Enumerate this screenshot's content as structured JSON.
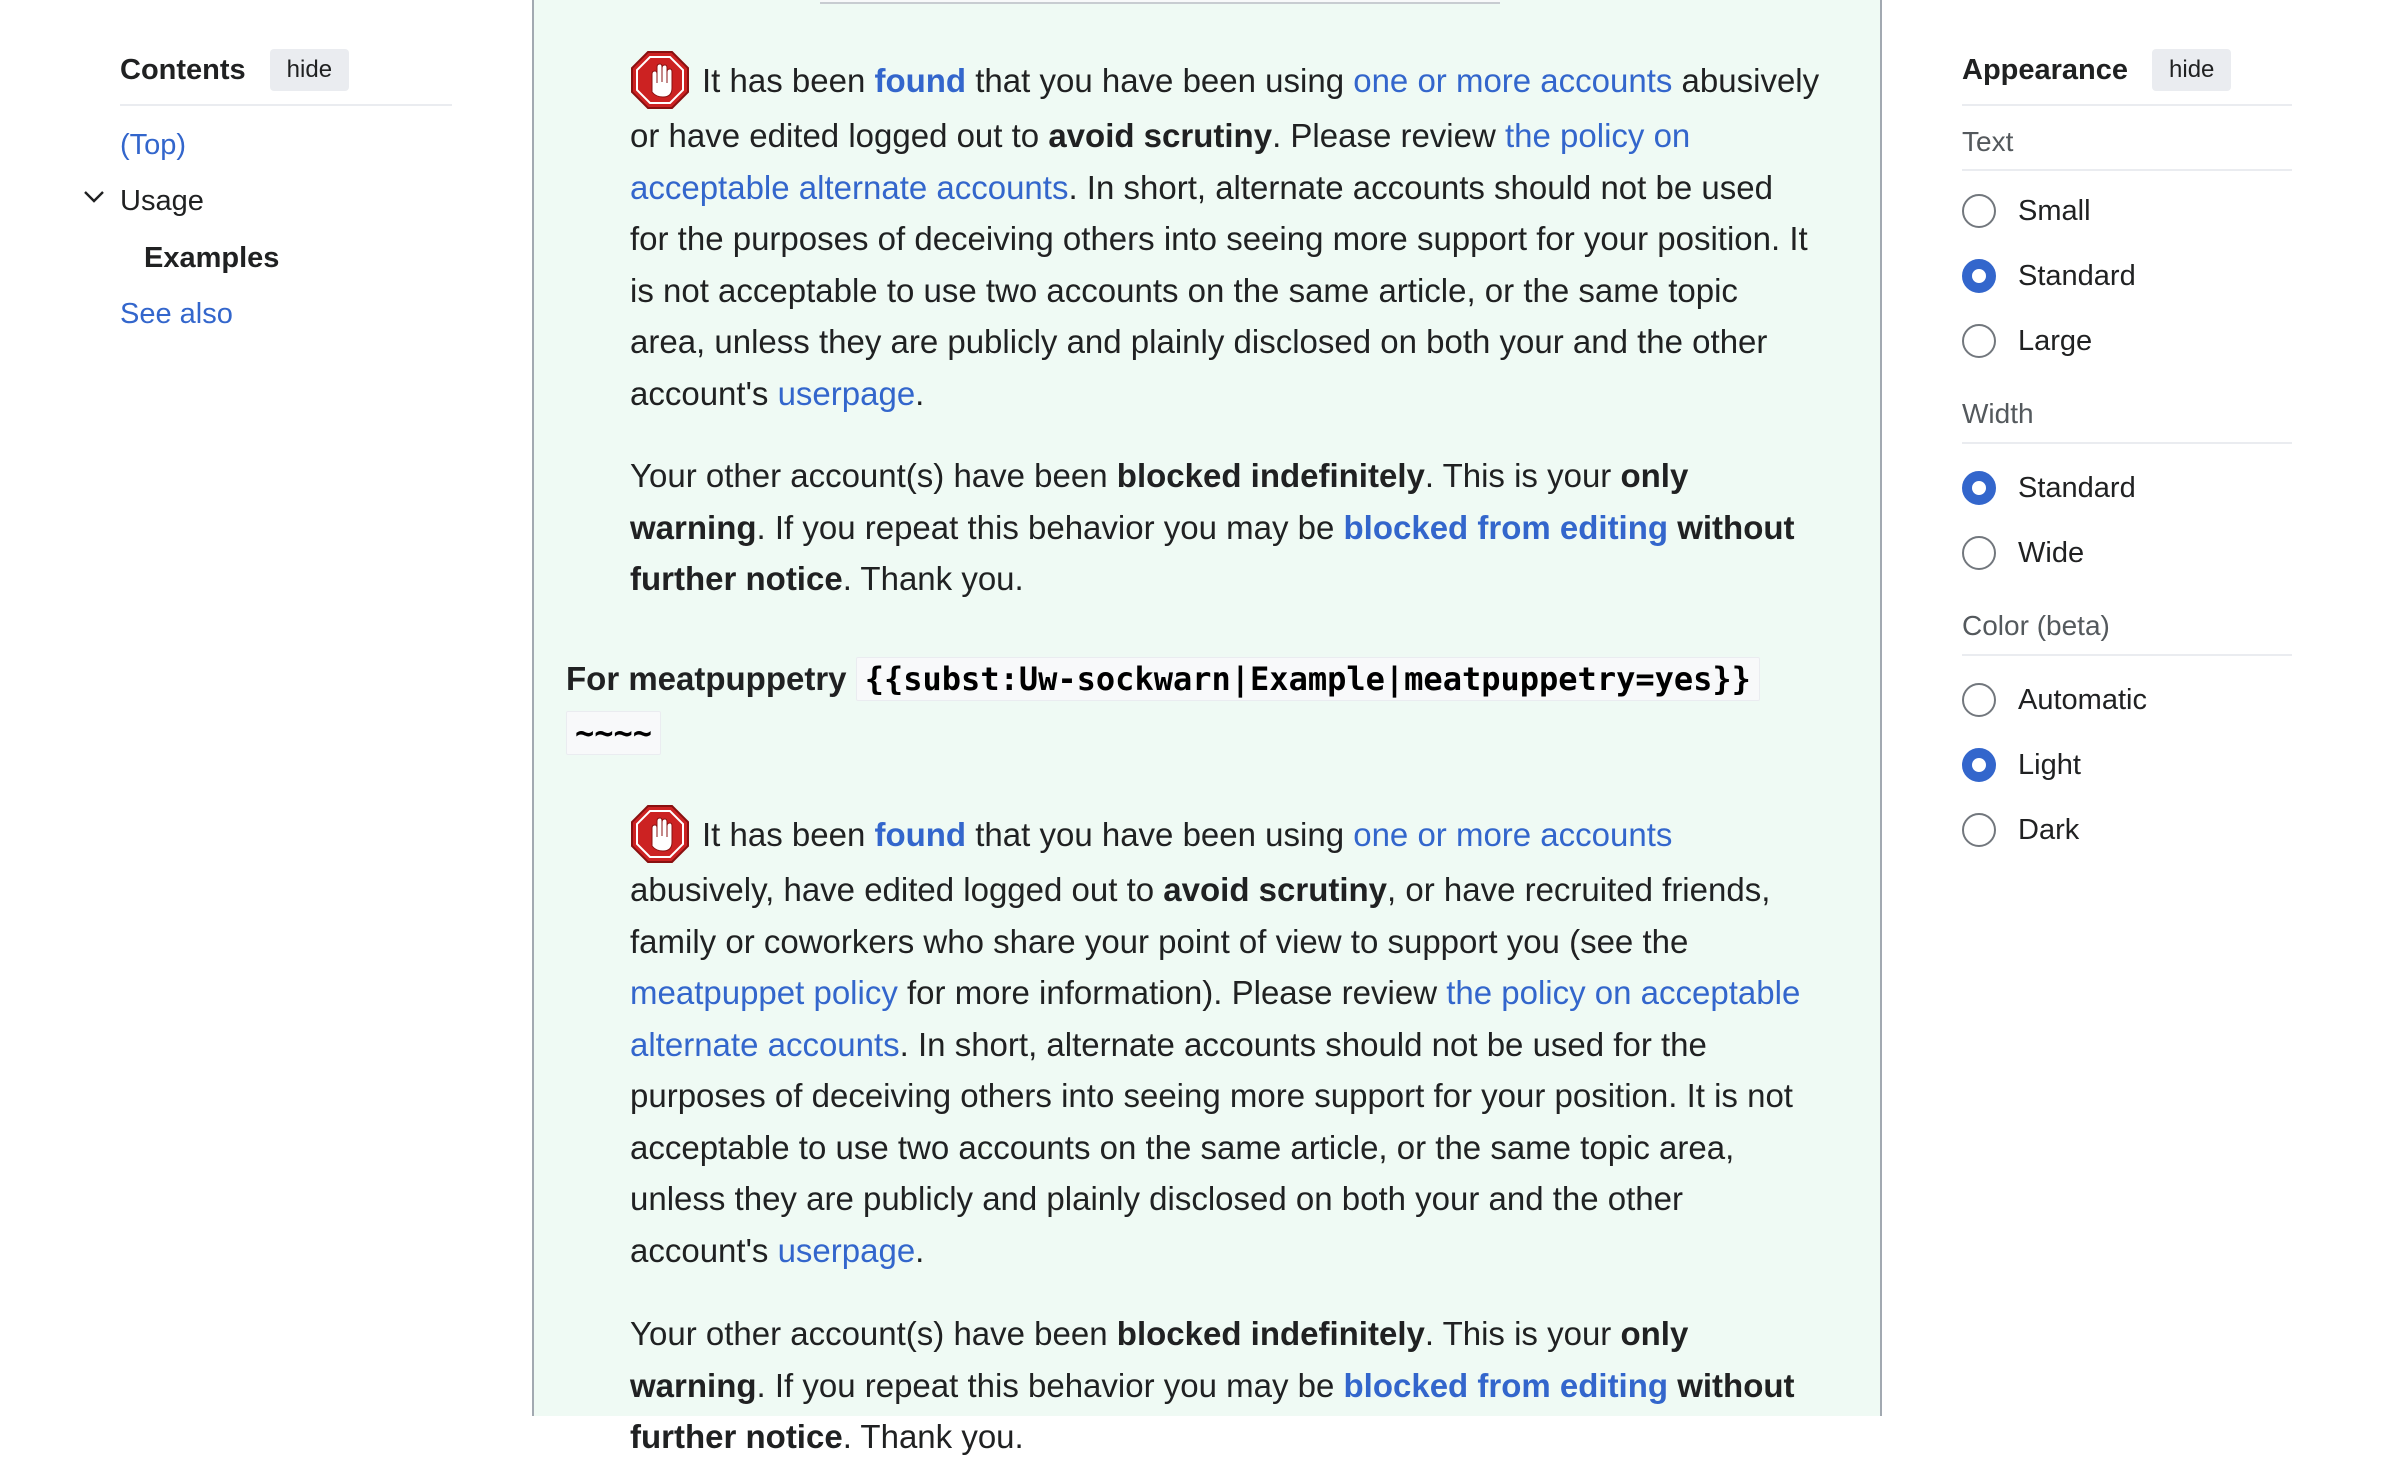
{
  "toc": {
    "title": "Contents",
    "hide_label": "hide",
    "items": [
      {
        "label": "(Top)"
      },
      {
        "label": "Usage"
      },
      {
        "label": "Examples"
      },
      {
        "label": "See also"
      }
    ]
  },
  "appearance": {
    "title": "Appearance",
    "hide_label": "hide",
    "text": {
      "label": "Text",
      "options": [
        "Small",
        "Standard",
        "Large"
      ],
      "selected": "Standard"
    },
    "width": {
      "label": "Width",
      "options": [
        "Standard",
        "Wide"
      ],
      "selected": "Standard"
    },
    "color": {
      "label": "Color (beta)",
      "options": [
        "Automatic",
        "Light",
        "Dark"
      ],
      "selected": "Light"
    }
  },
  "warning1": {
    "p1": {
      "t1": "It has been ",
      "found": "found",
      "t2": " that you have been using ",
      "accounts_link": "one or more accounts",
      "t3": " abusively or have edited logged out to ",
      "avoid": "avoid scrutiny",
      "t4": ". Please review ",
      "policy_link": "the policy on acceptable alternate accounts",
      "t5": ". In short, alternate accounts should not be used for the purposes of deceiving others into seeing more support for your position. It is not acceptable to use two accounts on the same article, or the same topic area, unless they are publicly and plainly disclosed on both your and the other account's ",
      "userpage_link": "userpage",
      "t6": "."
    },
    "p2": {
      "t1": "Your other account(s) have been ",
      "blocked": "blocked indefinitely",
      "t2": ". This is your ",
      "only": "only warning",
      "t3": ". If you repeat this behavior you may be ",
      "blocked_link": "blocked from editing",
      "t4": " ",
      "without": "without further notice",
      "t5": ". Thank you."
    }
  },
  "meat_heading": {
    "label": "For meatpuppetry",
    "code": "{{subst:Uw-sockwarn|Example|meatpuppetry=yes}}",
    "sig": "~~~~"
  },
  "warning2": {
    "p1": {
      "t1": "It has been ",
      "found": "found",
      "t2": " that you have been using ",
      "accounts_link": "one or more accounts",
      "t3": " abusively, have edited logged out to ",
      "avoid": "avoid scrutiny",
      "t4": ", or have recruited friends, family or coworkers who share your point of view to support you (see the ",
      "meat_link": "meatpuppet policy",
      "t5": " for more information). Please review ",
      "policy_link": "the policy on acceptable alternate accounts",
      "t6": ". In short, alternate accounts should not be used for the purposes of deceiving others into seeing more support for your position. It is not acceptable to use two accounts on the same article, or the same topic area, unless they are publicly and plainly disclosed on both your and the other account's ",
      "userpage_link": "userpage",
      "t7": "."
    },
    "p2": {
      "t1": "Your other account(s) have been ",
      "blocked": "blocked indefinitely",
      "t2": ". This is your ",
      "only": "only warning",
      "t3": ". If you repeat this behavior you may be ",
      "blocked_link": "blocked from editing",
      "t4": " ",
      "without": "without further notice",
      "t5": ". Thank you."
    }
  },
  "colors": {
    "link": "#3366cc",
    "content_bg": "#effaf4",
    "radio_checked": "#3366cc",
    "stop_icon": "#cc2222"
  }
}
